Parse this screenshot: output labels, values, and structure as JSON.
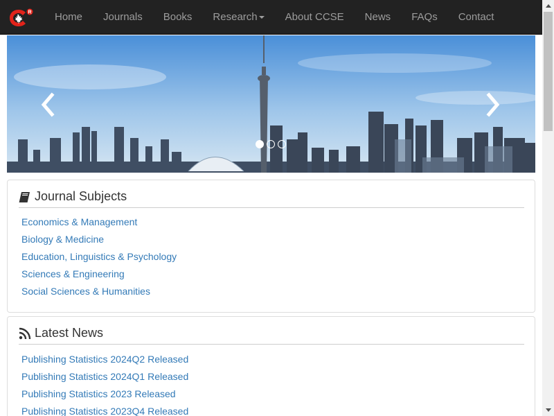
{
  "nav": {
    "items": [
      {
        "label": "Home"
      },
      {
        "label": "Journals"
      },
      {
        "label": "Books"
      },
      {
        "label": "Research",
        "dropdown": true
      },
      {
        "label": "About CCSE"
      },
      {
        "label": "News"
      },
      {
        "label": "FAQs"
      },
      {
        "label": "Contact"
      }
    ]
  },
  "carousel": {
    "slide_count": 3,
    "active_slide": 1
  },
  "subjects": {
    "title": "Journal Subjects",
    "icon": "book-icon",
    "items": [
      "Economics & Management",
      "Biology & Medicine",
      "Education, Linguistics & Psychology",
      "Sciences & Engineering",
      "Social Sciences & Humanities"
    ]
  },
  "news": {
    "title": "Latest News",
    "icon": "rss-icon",
    "items": [
      "Publishing Statistics 2024Q2 Released",
      "Publishing Statistics 2024Q1 Released",
      "Publishing Statistics 2023 Released",
      "Publishing Statistics 2023Q4 Released"
    ]
  },
  "colors": {
    "navbar_bg": "#222222",
    "nav_text": "#9d9d9d",
    "link": "#337ab7",
    "logo_red": "#e2231a"
  }
}
